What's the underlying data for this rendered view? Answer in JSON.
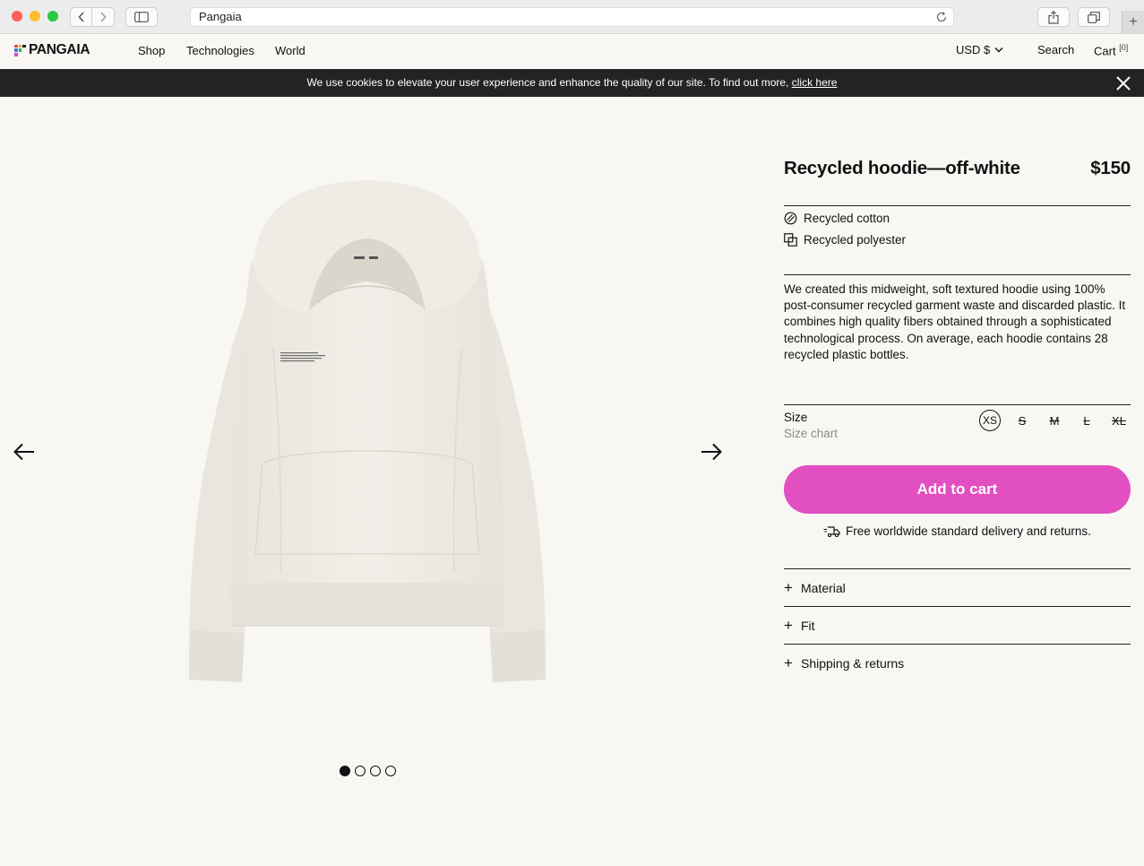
{
  "browser": {
    "address": "Pangaia",
    "newtab": "+"
  },
  "header": {
    "logo": "PANGAIA",
    "nav": [
      "Shop",
      "Technologies",
      "World"
    ],
    "currency": "USD $",
    "search": "Search",
    "cart": "Cart",
    "cart_count": "[0]"
  },
  "cookie": {
    "text": "We use cookies to elevate your user experience and enhance the quality of our site. To find out more,",
    "link": "click here"
  },
  "gallery": {
    "image_count": 4,
    "active_index": 0,
    "garment_color": "#efede6"
  },
  "product": {
    "title": "Recycled hoodie—off-white",
    "price": "$150",
    "features": [
      "Recycled cotton",
      "Recycled polyester"
    ],
    "description": "We created this midweight, soft textured hoodie using 100% post-consumer recycled garment waste and discarded plastic. It combines high quality fibers obtained through a sophisticated technological process. On average, each hoodie contains 28 recycled plastic bottles.",
    "size_label": "Size",
    "size_chart": "Size chart",
    "sizes": [
      {
        "label": "XS",
        "available": true
      },
      {
        "label": "S",
        "available": false
      },
      {
        "label": "M",
        "available": false
      },
      {
        "label": "L",
        "available": false
      },
      {
        "label": "XL",
        "available": false
      }
    ],
    "add_to_cart": "Add to cart",
    "delivery": "Free worldwide standard delivery and returns.",
    "accordions": [
      "Material",
      "Fit",
      "Shipping & returns"
    ]
  },
  "colors": {
    "accent": "#e14fc0",
    "background": "#f8f7f3",
    "banner": "#232323"
  }
}
